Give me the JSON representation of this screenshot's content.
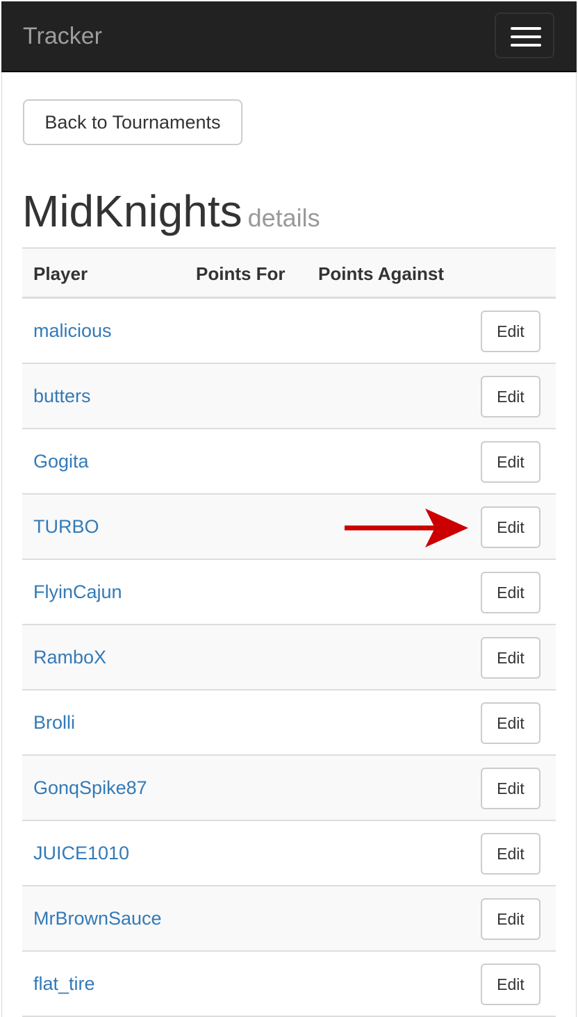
{
  "navbar": {
    "brand": "Tracker",
    "toggle_icon": "hamburger-menu-icon"
  },
  "back_button": {
    "label": "Back to Tournaments"
  },
  "page": {
    "title": "MidKnights",
    "subtitle": "details"
  },
  "table": {
    "headers": {
      "player": "Player",
      "points_for": "Points For",
      "points_against": "Points Against"
    },
    "rows": [
      {
        "player": "malicious",
        "edit_label": "Edit"
      },
      {
        "player": "butters",
        "edit_label": "Edit"
      },
      {
        "player": "Gogita",
        "edit_label": "Edit"
      },
      {
        "player": "TURBO",
        "edit_label": "Edit"
      },
      {
        "player": "FlyinCajun",
        "edit_label": "Edit"
      },
      {
        "player": "RamboX",
        "edit_label": "Edit"
      },
      {
        "player": "Brolli",
        "edit_label": "Edit"
      },
      {
        "player": "GonqSpike87",
        "edit_label": "Edit"
      },
      {
        "player": "JUICE1010",
        "edit_label": "Edit"
      },
      {
        "player": "MrBrownSauce",
        "edit_label": "Edit"
      },
      {
        "player": "flat_tire",
        "edit_label": "Edit"
      }
    ]
  },
  "annotation": {
    "arrow_icon": "red-arrow-icon",
    "arrow_color": "#cc0000",
    "points_to_row": "TURBO"
  },
  "colors": {
    "navbar_bg": "#222222",
    "brand": "#9d9d9d",
    "link": "#337ab7",
    "stripe": "#f9f9f9"
  }
}
